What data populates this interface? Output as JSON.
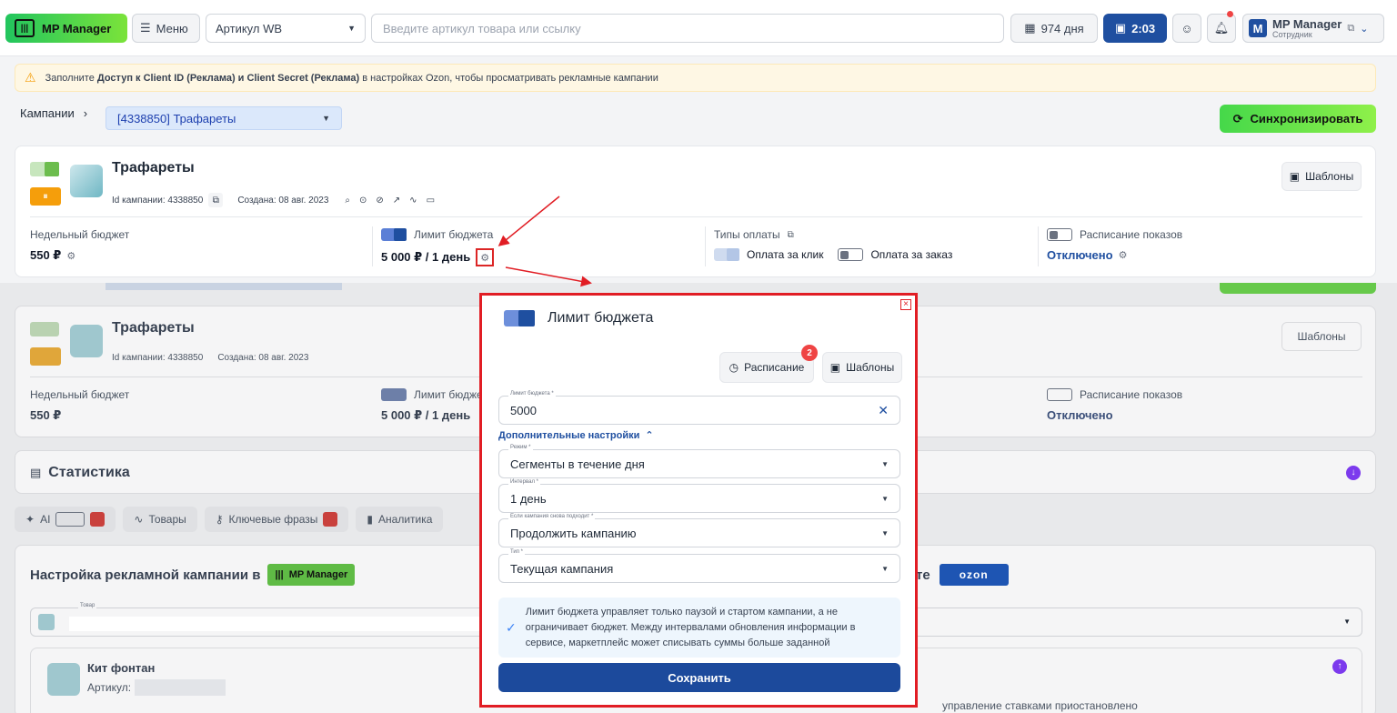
{
  "topbar": {
    "logo_text": "MP Manager",
    "menu_label": "Меню",
    "sku_select": "Артикул WB",
    "search_placeholder": "Введите артикул товара или ссылку",
    "days": "974 дня",
    "timer": "2:03",
    "profile_name": "MP Manager",
    "profile_role": "Сотрудник",
    "profile_initial": "M"
  },
  "notice": {
    "prefix": "Заполните ",
    "bold": "Доступ к Client ID (Реклама) и Client Secret (Реклама)",
    "suffix": " в настройках Ozon, чтобы просматривать рекламные кампании"
  },
  "breadcrumb": {
    "root": "Кампании",
    "selected": "[4338850] Трафареты"
  },
  "sync_label": "Синхронизировать",
  "campaign": {
    "title": "Трафареты",
    "id_text": "Id кампании: 4338850",
    "created": "Создана: 08 авг. 2023",
    "templates_label": "Шаблоны",
    "weekly_budget_label": "Недельный бюджет",
    "weekly_budget_value": "550 ₽",
    "limit_label": "Лимит бюджета",
    "limit_value": "5 000 ₽ / 1 день",
    "payment_types_label": "Типы оплаты",
    "pay_click": "Оплата за клик",
    "pay_order": "Оплата за заказ",
    "schedule_label": "Расписание показов",
    "schedule_value": "Отключено"
  },
  "background": {
    "stats_title": "Статистика",
    "tabs": [
      "AI",
      "Товары",
      "Ключевые фразы",
      "Аналитика"
    ],
    "setup_title": "Настройка рекламной кампании в",
    "mp_badge": "MP Manager",
    "ozon_suffix": "те",
    "ozon_logo": "ozon",
    "product_label": "Товар",
    "product_name": "Кит фонтан",
    "article_label": "Артикул:",
    "bottom_text": "управление ставками приостановлено"
  },
  "modal": {
    "title": "Лимит бюджета",
    "schedule_btn": "Расписание",
    "schedule_badge": "2",
    "templates_btn": "Шаблоны",
    "limit_field_label": "Лимит бюджета *",
    "limit_value": "5000",
    "advanced": "Дополнительные настройки",
    "mode_label": "Режим *",
    "mode_value": "Сегменты в течение дня",
    "interval_label": "Интервал *",
    "interval_value": "1 день",
    "again_label": "Если кампания снова подходит *",
    "again_value": "Продолжить кампанию",
    "type_label": "Тип *",
    "type_value": "Текущая кампания",
    "info": "Лимит бюджета управляет только паузой и стартом кампании, а не ограничивает бюджет. Между интервалами обновления информации в сервисе, маркетплейс может списывать суммы больше заданной",
    "save": "Сохранить"
  },
  "colors": {
    "brand_blue": "#1f4fa0",
    "green": "#45d84a",
    "annotation_red": "#e11d24"
  }
}
